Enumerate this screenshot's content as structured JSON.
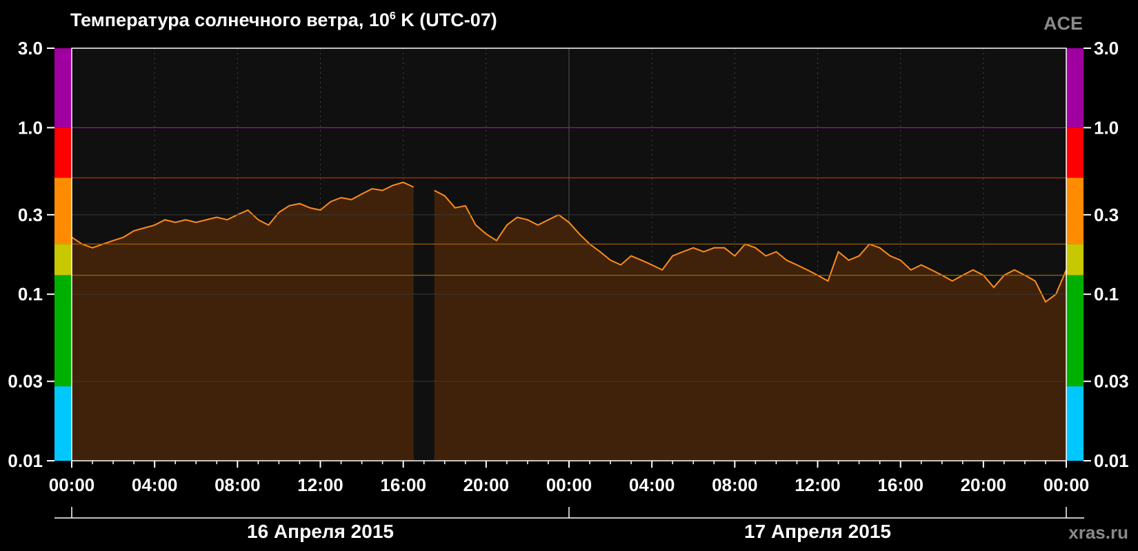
{
  "chart_data": {
    "type": "area",
    "title_main": "Температура солнечного ветра, 10",
    "title_sup": "6",
    "title_rest": " K (UTC-07)",
    "source": "ACE",
    "site": "xras.ru",
    "y_scale": "log",
    "ylim": [
      0.01,
      3.0
    ],
    "y_ticks": [
      "3.0",
      "1.0",
      "0.3",
      "0.1",
      "0.03",
      "0.01"
    ],
    "y_tick_values": [
      3.0,
      1.0,
      0.3,
      0.1,
      0.03,
      0.01
    ],
    "x_ticks": [
      "00:00",
      "04:00",
      "08:00",
      "12:00",
      "16:00",
      "20:00",
      "00:00",
      "04:00",
      "08:00",
      "12:00",
      "16:00",
      "20:00",
      "00:00"
    ],
    "x_range_hours": [
      0,
      48
    ],
    "dates": [
      "16 Апреля 2015",
      "17 Апреля 2015"
    ],
    "thresholds": [
      {
        "value": 1.0,
        "color": "#b000c0"
      },
      {
        "value": 0.5,
        "color": "#c03a00"
      },
      {
        "value": 0.2,
        "color": "#a06000"
      },
      {
        "value": 0.13,
        "color": "#906a00"
      }
    ],
    "color_bands": [
      {
        "from": 1.0,
        "to": 3.0,
        "color": "#a000a0"
      },
      {
        "from": 0.5,
        "to": 1.0,
        "color": "#ff0000"
      },
      {
        "from": 0.2,
        "to": 0.5,
        "color": "#ff8c00"
      },
      {
        "from": 0.13,
        "to": 0.2,
        "color": "#c8c800"
      },
      {
        "from": 0.028,
        "to": 0.13,
        "color": "#00b000"
      },
      {
        "from": 0.01,
        "to": 0.028,
        "color": "#00c8ff"
      }
    ],
    "series": [
      {
        "line_color": "#ff8c1a",
        "fill_color": "#40220a",
        "x": [
          0.0,
          0.5,
          1.0,
          1.5,
          2.0,
          2.5,
          3.0,
          3.5,
          4.0,
          4.5,
          5.0,
          5.5,
          6.0,
          6.5,
          7.0,
          7.5,
          8.0,
          8.5,
          9.0,
          9.5,
          10.0,
          10.5,
          11.0,
          11.5,
          12.0,
          12.5,
          13.0,
          13.5,
          14.0,
          14.5,
          15.0,
          15.5,
          16.0,
          16.5,
          17.5,
          18.0,
          18.5,
          19.0,
          19.5,
          20.0,
          20.5,
          21.0,
          21.5,
          22.0,
          22.5,
          23.0,
          23.5,
          24.0,
          24.5,
          25.0,
          25.5,
          26.0,
          26.5,
          27.0,
          27.5,
          28.0,
          28.5,
          29.0,
          29.5,
          30.0,
          30.5,
          31.0,
          31.5,
          32.0,
          32.5,
          33.0,
          33.5,
          34.0,
          34.5,
          35.0,
          35.5,
          36.0,
          36.5,
          37.0,
          37.5,
          38.0,
          38.5,
          39.0,
          39.5,
          40.0,
          40.5,
          41.0,
          41.5,
          42.0,
          42.5,
          43.0,
          43.5,
          44.0,
          44.5,
          45.0,
          45.5,
          46.0,
          46.5,
          47.0,
          47.5,
          48.0
        ],
        "y": [
          0.22,
          0.2,
          0.19,
          0.2,
          0.21,
          0.22,
          0.24,
          0.25,
          0.26,
          0.28,
          0.27,
          0.28,
          0.27,
          0.28,
          0.29,
          0.28,
          0.3,
          0.32,
          0.28,
          0.26,
          0.31,
          0.34,
          0.35,
          0.33,
          0.32,
          0.36,
          0.38,
          0.37,
          0.4,
          0.43,
          0.42,
          0.45,
          0.47,
          0.44,
          0.42,
          0.39,
          0.33,
          0.34,
          0.26,
          0.23,
          0.21,
          0.26,
          0.29,
          0.28,
          0.26,
          0.28,
          0.3,
          0.27,
          0.23,
          0.2,
          0.18,
          0.16,
          0.15,
          0.17,
          0.16,
          0.15,
          0.14,
          0.17,
          0.18,
          0.19,
          0.18,
          0.19,
          0.19,
          0.17,
          0.2,
          0.19,
          0.17,
          0.18,
          0.16,
          0.15,
          0.14,
          0.13,
          0.12,
          0.18,
          0.16,
          0.17,
          0.2,
          0.19,
          0.17,
          0.16,
          0.14,
          0.15,
          0.14,
          0.13,
          0.12,
          0.13,
          0.14,
          0.13,
          0.11,
          0.13,
          0.14,
          0.13,
          0.12,
          0.09,
          0.1,
          0.14
        ]
      }
    ],
    "gaps_hours": [
      [
        16.5,
        17.5
      ]
    ]
  }
}
